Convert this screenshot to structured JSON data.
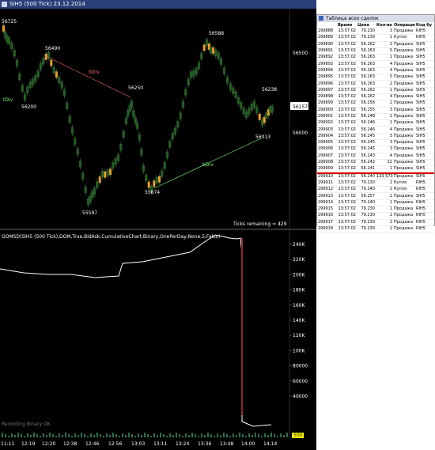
{
  "window": {
    "title": "SIH5 (500 Tick)  23.12.2014"
  },
  "price_panel": {
    "axis_labels": [
      "56500",
      "56000"
    ],
    "current_price": "56157",
    "annotations": [
      "56725",
      "56490",
      "56200",
      "56588",
      "56250",
      "56238",
      "56013",
      "55674",
      "55597"
    ],
    "divergences": [
      "tDiv",
      "bDiv",
      "bDiv"
    ],
    "ticks_remaining": "Ticks remaining = 429"
  },
  "indicator_panel": {
    "title": "GOMSD(SIH5  (500  Tick),DOM,True,BidAsk,CumulativeChart,Binary,OnePerDay,None,5,False)",
    "axis_labels": [
      "240K",
      "220K",
      "200K",
      "180K",
      "160K",
      "140K",
      "120K",
      "100K",
      "80000",
      "60000",
      "40000"
    ],
    "recording_status": "Recording Binary OK",
    "bottom_value": "500"
  },
  "time_axis": [
    "11:11",
    "12:19",
    "12:20",
    "12:38",
    "12:46",
    "12:56",
    "13:03",
    "13:11",
    "13:24",
    "13:36",
    "13:48",
    "14:00",
    "14:14"
  ],
  "trades_table": {
    "title": "Таблица всех сделок",
    "columns": [
      "",
      "Время",
      "Цена",
      "Кол-во",
      "Операция",
      "Код бу"
    ],
    "rows": [
      [
        "299888",
        "13:57:02",
        "79.230",
        "3",
        "Продажа",
        "RIH5"
      ],
      [
        "299889",
        "13:57:02",
        "79.230",
        "1",
        "Купля",
        "RIH5"
      ],
      [
        "299890",
        "13:57:02",
        "56.262",
        "2",
        "Продажа",
        "SIH5"
      ],
      [
        "299891",
        "13:57:02",
        "56.263",
        "5",
        "Продажа",
        "SIH5"
      ],
      [
        "299892",
        "13:57:02",
        "56.263",
        "1",
        "Продажа",
        "SIH5"
      ],
      [
        "299893",
        "13:57:02",
        "56.263",
        "4",
        "Продажа",
        "SIH5"
      ],
      [
        "299894",
        "13:57:02",
        "56.263",
        "4",
        "Продажа",
        "SIH5"
      ],
      [
        "299895",
        "13:57:02",
        "56.263",
        "5",
        "Продажа",
        "SIH5"
      ],
      [
        "299896",
        "13:57:02",
        "56.263",
        "2",
        "Продажа",
        "SIH5"
      ],
      [
        "299897",
        "13:57:02",
        "56.262",
        "1",
        "Продажа",
        "SIH5"
      ],
      [
        "299898",
        "13:57:02",
        "56.262",
        "4",
        "Продажа",
        "SIH5"
      ],
      [
        "299899",
        "13:57:02",
        "56.256",
        "2",
        "Продажа",
        "SIH5"
      ],
      [
        "299900",
        "13:57:02",
        "56.255",
        "3",
        "Продажа",
        "SIH5"
      ],
      [
        "299901",
        "13:57:02",
        "56.248",
        "1",
        "Продажа",
        "SIH5"
      ],
      [
        "299902",
        "13:57:02",
        "56.246",
        "1",
        "Продажа",
        "SIH5"
      ],
      [
        "299903",
        "13:57:02",
        "56.246",
        "4",
        "Продажа",
        "SIH5"
      ],
      [
        "299904",
        "13:57:02",
        "56.245",
        "3",
        "Продажа",
        "SIH5"
      ],
      [
        "299905",
        "13:57:02",
        "56.245",
        "3",
        "Продажа",
        "SIH5"
      ],
      [
        "299906",
        "13:57:02",
        "56.245",
        "3",
        "Продажа",
        "SIH5"
      ],
      [
        "299907",
        "13:57:02",
        "56.243",
        "4",
        "Продажа",
        "SIH5"
      ],
      [
        "299908",
        "13:57:02",
        "56.242",
        "22",
        "Продажа",
        "SIH5"
      ],
      [
        "299909",
        "13:57:02",
        "56.241",
        "1",
        "Продажа",
        "SIH5"
      ],
      [
        "299910",
        "13:57:02",
        "56.240",
        "133 573",
        "Продажа",
        "SIH5"
      ],
      [
        "299911",
        "13:57:02",
        "79.230",
        "2",
        "Купля",
        "RIH5"
      ],
      [
        "299912",
        "13:57:02",
        "79.240",
        "1",
        "Купля",
        "RIH5"
      ],
      [
        "299913",
        "13:57:02",
        "56.257",
        "1",
        "Продажа",
        "SIH5"
      ],
      [
        "299914",
        "13:57:02",
        "79.240",
        "1",
        "Продажа",
        "RIH5"
      ],
      [
        "299915",
        "13:57:02",
        "79.230",
        "1",
        "Продажа",
        "RIH5"
      ],
      [
        "299916",
        "13:57:02",
        "79.230",
        "2",
        "Продажа",
        "RIH5"
      ],
      [
        "299917",
        "13:57:02",
        "79.230",
        "2",
        "Продажа",
        "RIH5"
      ],
      [
        "299918",
        "13:57:02",
        "79.230",
        "1",
        "Продажа",
        "RIH5"
      ]
    ]
  },
  "colors": {
    "background": "#000000",
    "titlebar": "#2a3f77",
    "div_red": "#ff6b6b",
    "div_green": "#7cff7c",
    "highlight_red": "#d40000"
  }
}
